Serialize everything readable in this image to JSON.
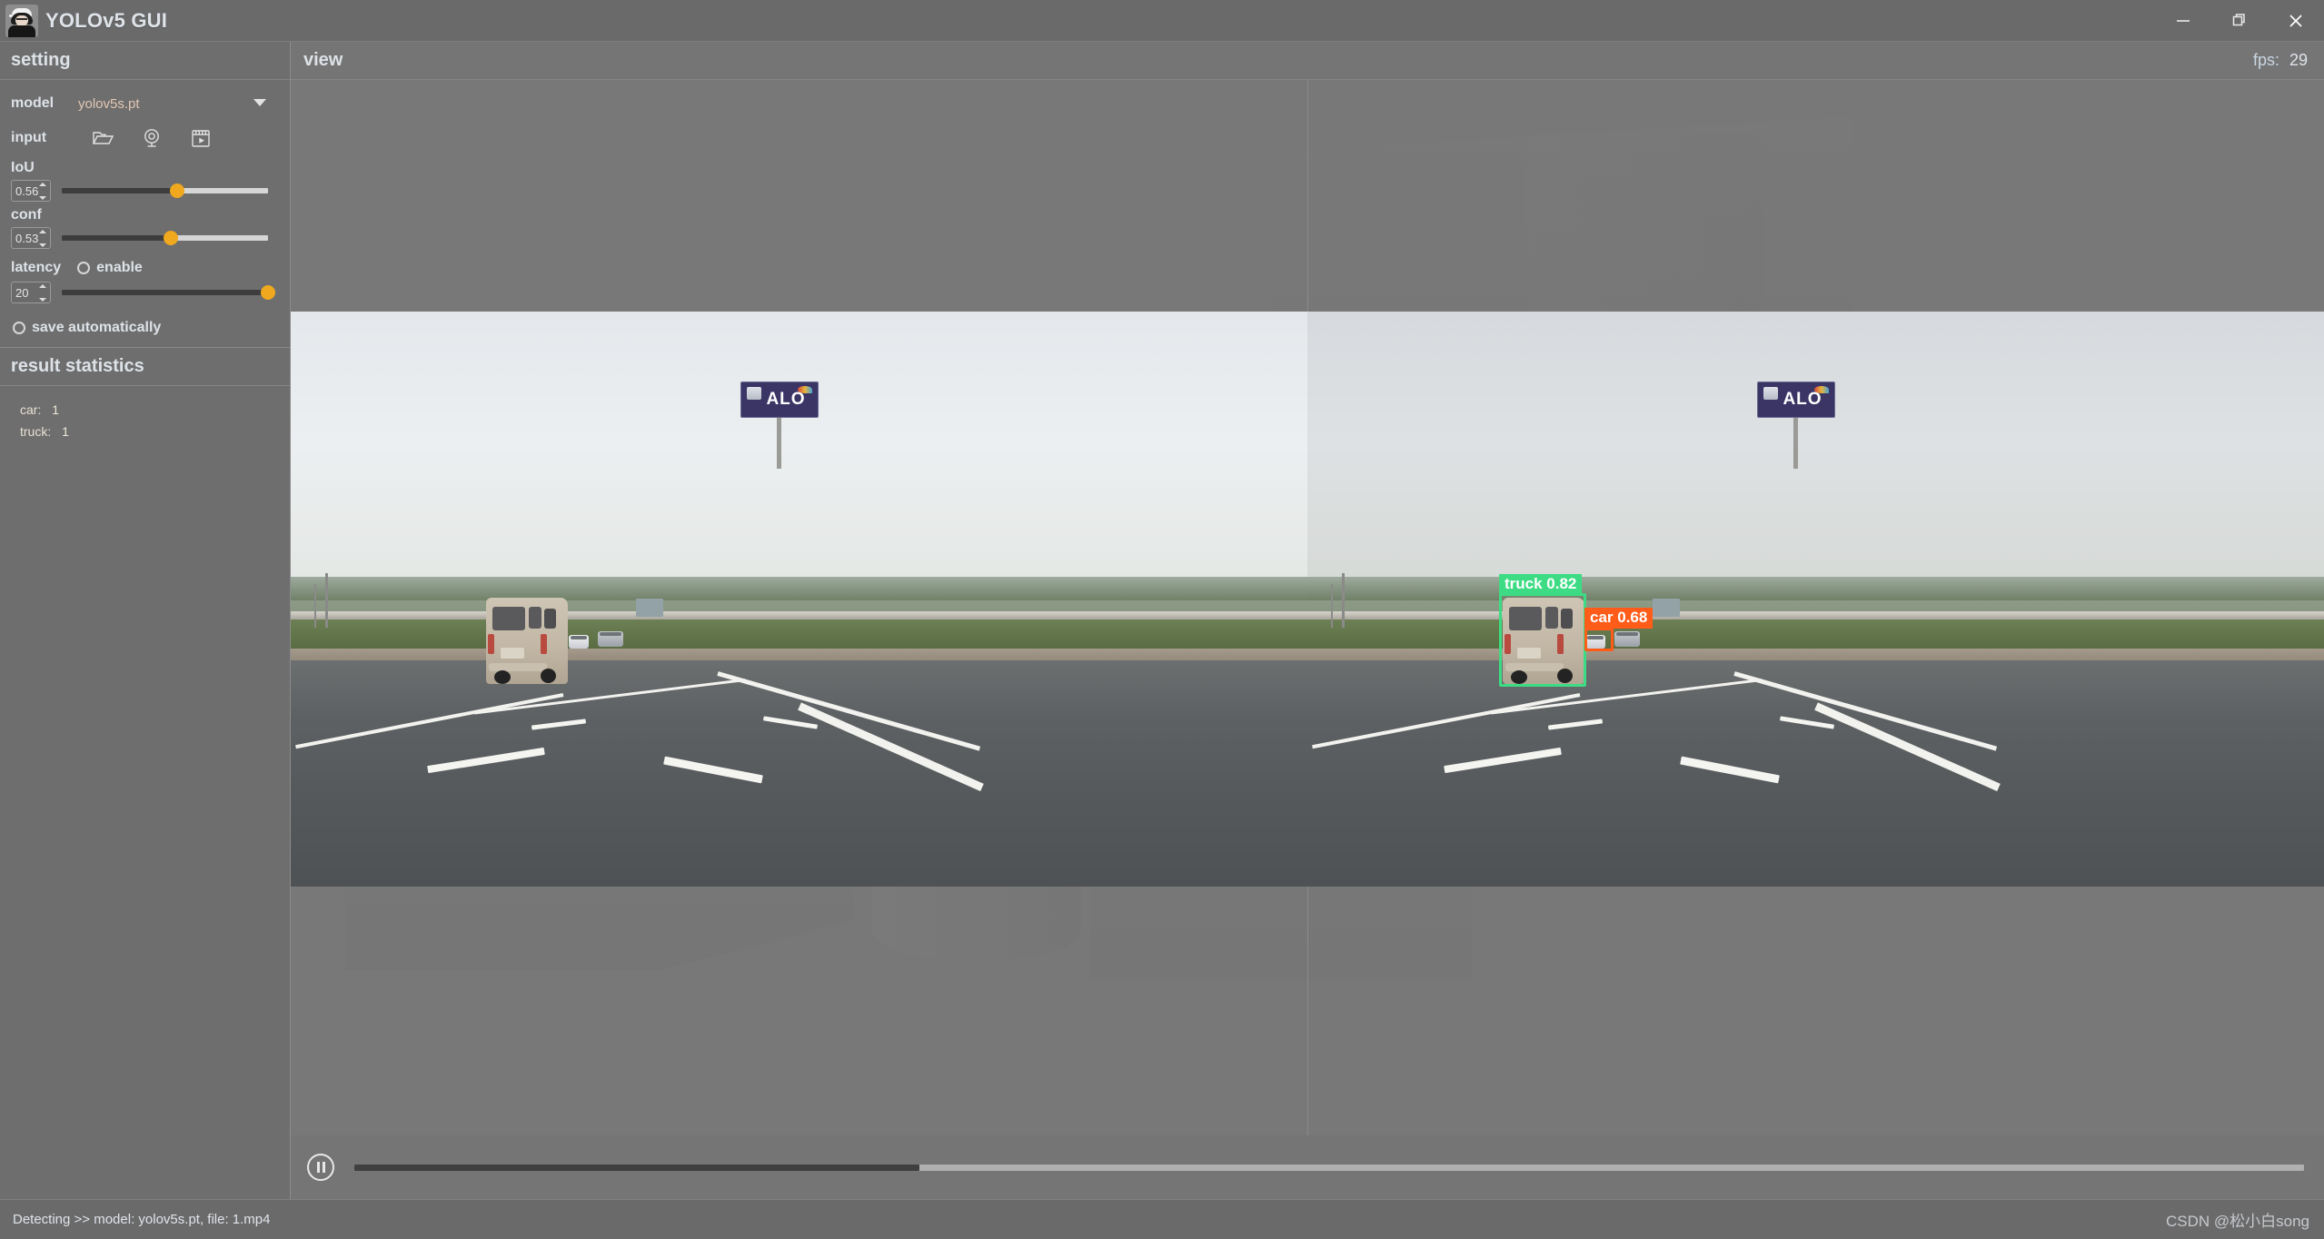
{
  "titlebar": {
    "logo_icon": "avatar-icon",
    "title": "YOLOv5 GUI",
    "minimize_icon": "minimize-icon",
    "maximize_icon": "maximize-restore-icon",
    "close_icon": "close-icon"
  },
  "sidebar": {
    "settings_header": "setting",
    "model": {
      "label": "model",
      "value": "yolov5s.pt",
      "caret_icon": "chevron-down-icon"
    },
    "input": {
      "label": "input",
      "buttons": [
        {
          "name": "open-folder-icon",
          "title": "folder"
        },
        {
          "name": "webcam-icon",
          "title": "camera"
        },
        {
          "name": "video-file-icon",
          "title": "video"
        }
      ]
    },
    "iou": {
      "label": "IoU",
      "value": "0.56",
      "percent": 56
    },
    "conf": {
      "label": "conf",
      "value": "0.53",
      "percent": 53
    },
    "latency": {
      "label": "latency",
      "enable_label": "enable",
      "enabled": false,
      "value": "20",
      "percent": 100
    },
    "save_auto": {
      "label": "save automatically",
      "checked": false
    },
    "statistics_header": "result statistics",
    "statistics": [
      {
        "key": "car:",
        "value": "1"
      },
      {
        "key": "truck:",
        "value": "1"
      }
    ]
  },
  "view": {
    "title": "view",
    "fps_label": "fps:",
    "fps_value": "29",
    "billboard_text": "ALO",
    "detections": [
      {
        "label": "truck  0.82",
        "class": "truck",
        "confidence": "0.82",
        "color": "#3ddc84"
      },
      {
        "label": "car  0.68",
        "class": "car",
        "confidence": "0.68",
        "color": "#ff5c1a"
      }
    ]
  },
  "playback": {
    "pause_icon": "pause-icon",
    "progress_percent": 29
  },
  "statusbar": {
    "text": "Detecting >> model:  yolov5s.pt,  file:  1.mp4",
    "watermark": "CSDN @松小白song"
  },
  "colors": {
    "accent": "#f0a81e",
    "truck_box": "#3ddc84",
    "car_box": "#ff5c1a",
    "panel_bg": "#6e6e6e",
    "text": "#dde2e8"
  }
}
